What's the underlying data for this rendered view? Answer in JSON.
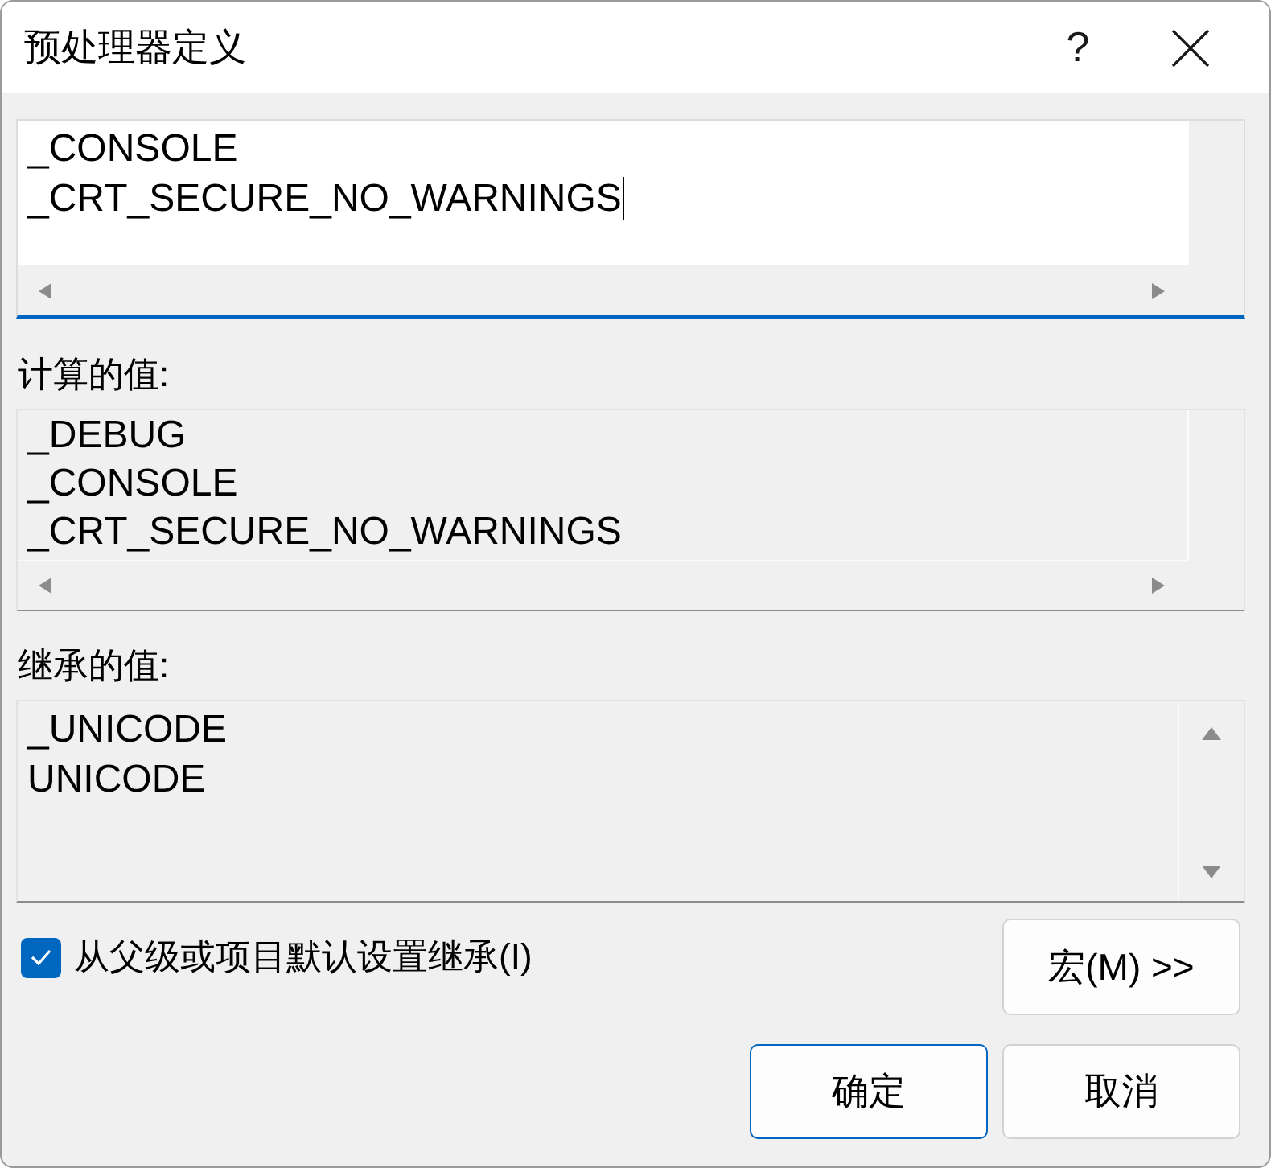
{
  "window": {
    "title": "预处理器定义",
    "help": "?"
  },
  "definitions": {
    "lines": [
      "_CONSOLE",
      "_CRT_SECURE_NO_WARNINGS"
    ],
    "focused": true
  },
  "evaluated": {
    "label": "计算的值:",
    "lines": [
      "_DEBUG",
      "_CONSOLE",
      "_CRT_SECURE_NO_WARNINGS"
    ]
  },
  "inherited": {
    "label": "继承的值:",
    "lines": [
      "_UNICODE",
      "UNICODE"
    ]
  },
  "inherit_checkbox": {
    "label": "从父级或项目默认设置继承(I)",
    "checked": true
  },
  "macros_button": {
    "label": "宏(M) >>"
  },
  "buttons": [
    {
      "label": "确定",
      "default": true
    },
    {
      "label": "取消",
      "default": false
    }
  ]
}
